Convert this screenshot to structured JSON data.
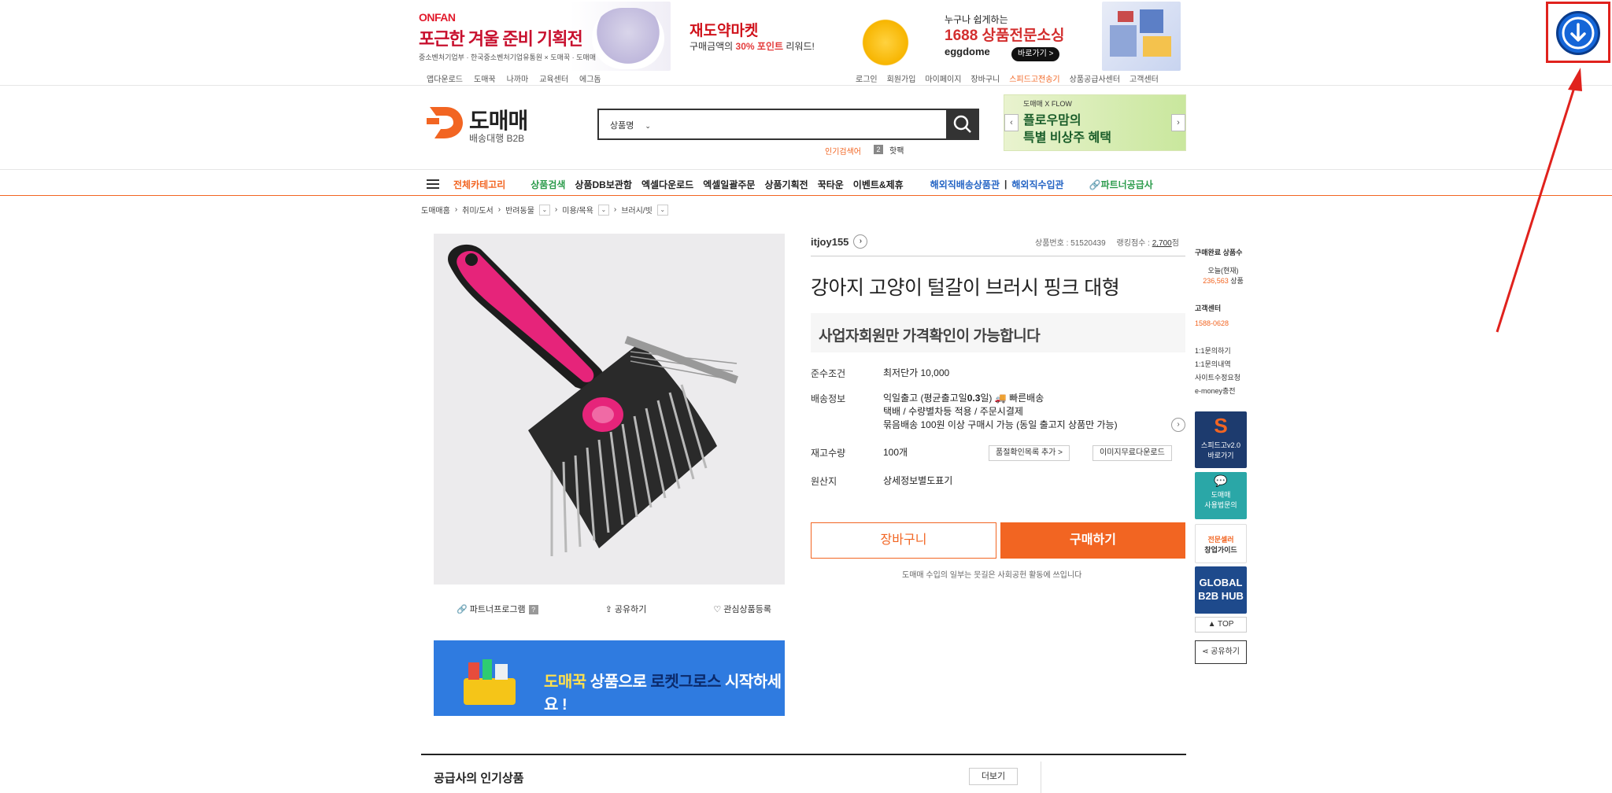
{
  "banners": {
    "onfan_brand": "ONFAN",
    "onfan_title": "포근한 겨울 준비 기획전",
    "onfan_partners": "중소벤처기업부 · 한국중소벤처기업유통원 × 도매꾹 · 도매매",
    "market_title": "재도약마켓",
    "market_sub_prefix": "구매금액의 ",
    "market_sub_highlight": "30% 포인트",
    "market_sub_suffix": " 리워드!",
    "egg_line1": "누구나 쉽게하는",
    "egg_line2": "1688 상품전문소싱",
    "egg_logo": "eggdome",
    "egg_button": "바로가기 >"
  },
  "util_nav_left": [
    "앱다운로드",
    "도매꾹",
    "나까마",
    "교육센터",
    "에그돔"
  ],
  "util_nav_right": [
    "로그인",
    "회원가입",
    "마이페이지",
    "장바구니",
    "스피드고전송기",
    "상품공급사센터",
    "고객센터"
  ],
  "header": {
    "logo_name": "도매매",
    "logo_sub": "배송대행 B2B",
    "search_select": "상품명",
    "popular_label": "인기검색어",
    "popular_rank": "2",
    "popular_keyword": "핫팩",
    "ad_line1": "도매매 X FLOW",
    "ad_line2": "플로우맘의",
    "ad_line3": "특별 비상주 혜택"
  },
  "nav": {
    "category": "전체카테고리",
    "items": [
      "상품검색",
      "상품DB보관함",
      "엑셀다운로드",
      "엑셀일괄주문",
      "상품기획전",
      "꾹타운",
      "이벤트&제휴"
    ],
    "overseas1": "해외직배송상품관",
    "overseas_sep": "|",
    "overseas2": "해외직수입관",
    "partner": "파트너공급사"
  },
  "breadcrumb": [
    "도매매홈",
    "취미/도서",
    "반려동물",
    "미용/목욕",
    "브러시/빗"
  ],
  "image_actions": {
    "partner": "파트너프로그램",
    "partner_q": "?",
    "share": "공유하기",
    "wish": "관심상품등록"
  },
  "promo": {
    "part1": "도매꾹",
    "part2": " 상품으로 ",
    "part3": "로켓그로스",
    "part4": " 시작하세요 !"
  },
  "product": {
    "seller": "itjoy155",
    "product_no": "상품번호 : 51520439",
    "rank_score_label": "랭킹점수 : ",
    "rank_score_value": "2,700",
    "rank_score_unit": "점",
    "title": "강아지 고양이 털갈이 브러시 핑크 대형",
    "price_notice": "사업자회원만 가격확인이 가능합니다",
    "rows": {
      "condition_label": "준수조건",
      "condition_value": "최저단가 10,000",
      "shipping_label": "배송정보",
      "shipping_line1_pre": "익일출고 (평균출고일",
      "shipping_line1_bold": "0.3",
      "shipping_line1_post": "일)",
      "shipping_fast": "빠른배송",
      "shipping_line2": "택배 / 수량별차등 적용 / 주문시결제",
      "shipping_line3": "묶음배송 100원 이상 구매시 가능 (동일 출고지 상품만 가능)",
      "stock_label": "재고수량",
      "stock_value": "100개",
      "quality_btn": "품절확인목록 추가 >",
      "image_btn": "이미지무료다운로드",
      "origin_label": "원산지",
      "origin_value": "상세정보별도표기"
    },
    "cart_button": "장바구니",
    "buy_button": "구매하기",
    "notice": "도매매 수입의 일부는 뭇길은 사회공헌 활동에 쓰입니다"
  },
  "sidebar": {
    "purchase_title": "구매완료 상품수",
    "today_label": "오늘(현재)",
    "today_count": "236,563",
    "today_unit": " 상품",
    "cs_title": "고객센터",
    "cs_phone": "1588-0628",
    "links": [
      "1:1문의하기",
      "1:1문의내역",
      "사이트수정요청",
      "e-money충전"
    ],
    "tile1_line1": "스피드고v2.0",
    "tile1_line2": "바로가기",
    "tile2_line1": "도매매",
    "tile2_line2": "사용법문의",
    "tile3_line1": "전문셀러",
    "tile3_line2": "창업가이드",
    "tile4_line1": "GLOBAL",
    "tile4_line2": "B2B HUB",
    "top_button": "▲ TOP",
    "share_button": "공유하기"
  },
  "bottom": {
    "title": "공급사의 인기상품",
    "more": "더보기"
  },
  "colors": {
    "accent": "#f26522",
    "annotation": "#e0221d",
    "download_icon_bg": "#1566d8"
  },
  "annotation": {
    "icon": "download-arrow-icon"
  }
}
